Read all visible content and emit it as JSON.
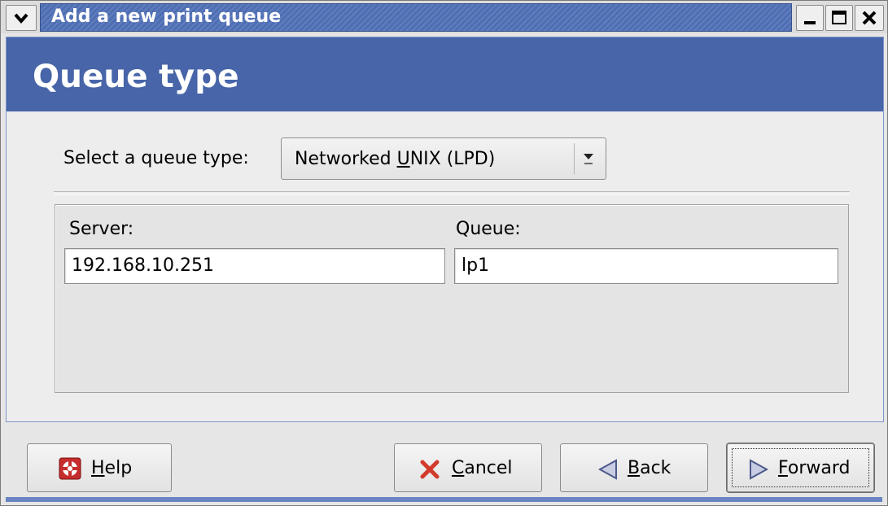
{
  "window": {
    "title": "Add a new print queue",
    "accent_color": "#4765a8"
  },
  "header": {
    "title": "Queue type"
  },
  "queue_type": {
    "label": "Select a queue type:",
    "selected_prefix": "Networked ",
    "selected_mnemonic": "U",
    "selected_suffix": "NIX (LPD)"
  },
  "fields": {
    "server_label": "Server:",
    "server_value": "192.168.10.251",
    "queue_label": "Queue:",
    "queue_value": "lp1"
  },
  "buttons": {
    "help": {
      "mnemonic": "H",
      "rest": "elp",
      "icon": "lifebuoy-icon"
    },
    "cancel": {
      "mnemonic": "C",
      "rest": "ancel",
      "icon": "x-icon"
    },
    "back": {
      "mnemonic": "B",
      "rest": "ack",
      "icon": "left-arrow-icon"
    },
    "forward": {
      "mnemonic": "F",
      "rest": "orward",
      "icon": "right-arrow-icon"
    }
  }
}
